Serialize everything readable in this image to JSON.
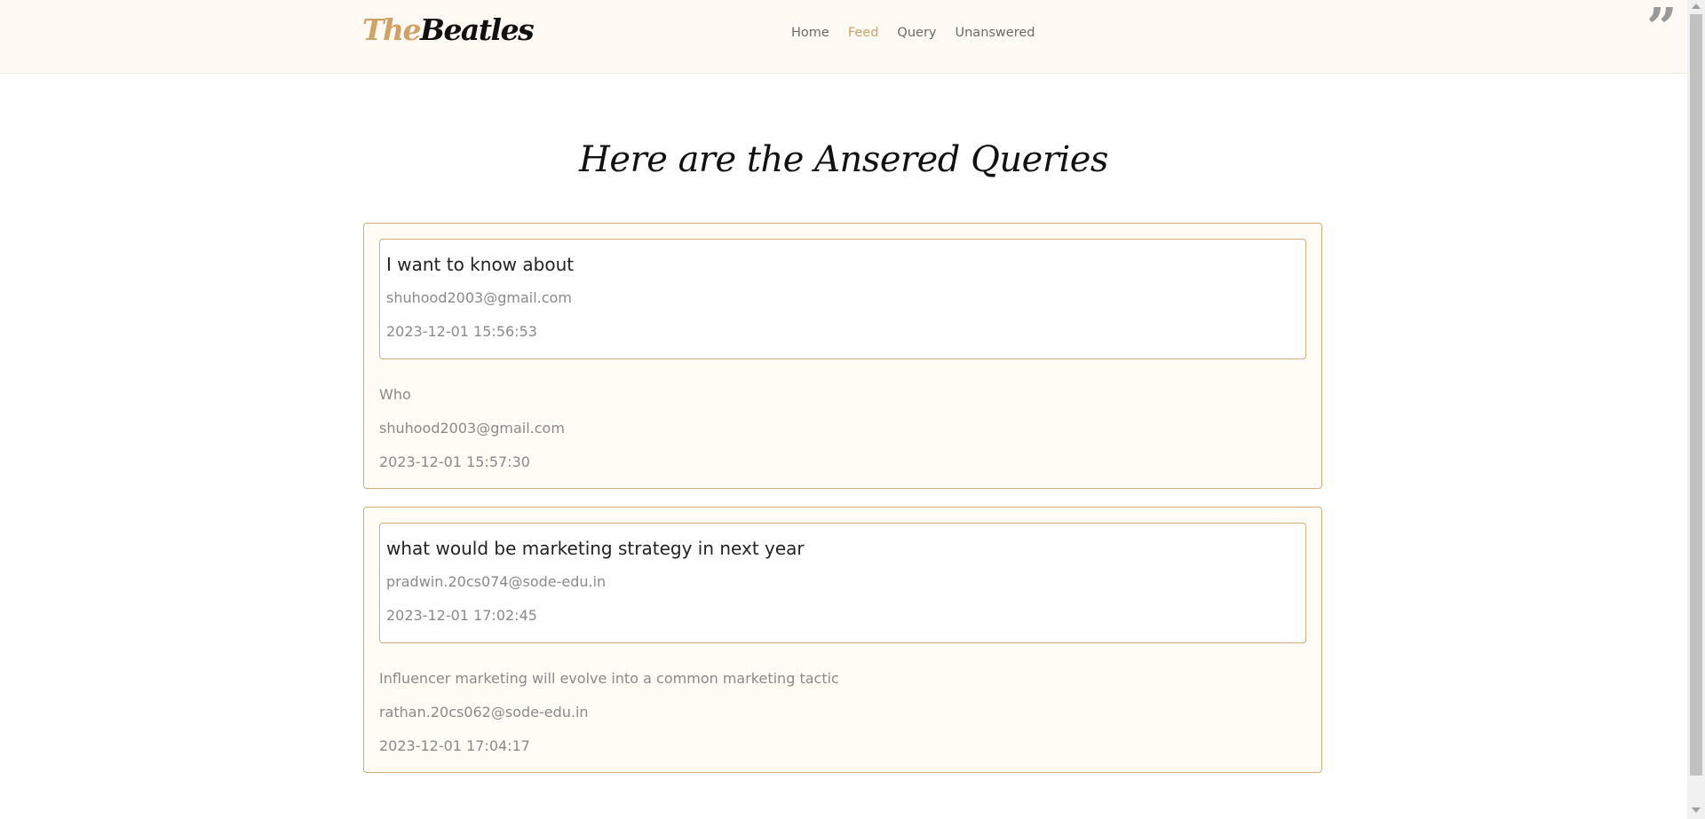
{
  "brand": {
    "logo_the": "The",
    "logo_beatles": "Beatles"
  },
  "nav": {
    "items": [
      {
        "label": "Home",
        "active": false
      },
      {
        "label": "Feed",
        "active": true
      },
      {
        "label": "Query",
        "active": false
      },
      {
        "label": "Unanswered",
        "active": false
      }
    ]
  },
  "header_icon": {
    "name": "quote-icon",
    "glyph": "”"
  },
  "page": {
    "title": "Here are the Ansered Queries"
  },
  "queries": [
    {
      "question": "I want to know about",
      "question_email": "shuhood2003@gmail.com",
      "question_time": "2023-12-01 15:56:53",
      "answer": "Who",
      "answer_email": "shuhood2003@gmail.com",
      "answer_time": "2023-12-01 15:57:30"
    },
    {
      "question": "what would be marketing strategy in next year",
      "question_email": "pradwin.20cs074@sode-edu.in",
      "question_time": "2023-12-01 17:02:45",
      "answer": "Influencer marketing will evolve into a common marketing tactic",
      "answer_email": "rathan.20cs062@sode-edu.in",
      "answer_time": "2023-12-01 17:04:17"
    }
  ],
  "colors": {
    "accent": "#d1a265",
    "card_border": "#d3b077",
    "header_bg": "#fffaf3",
    "card_bg": "#fffbf5"
  }
}
